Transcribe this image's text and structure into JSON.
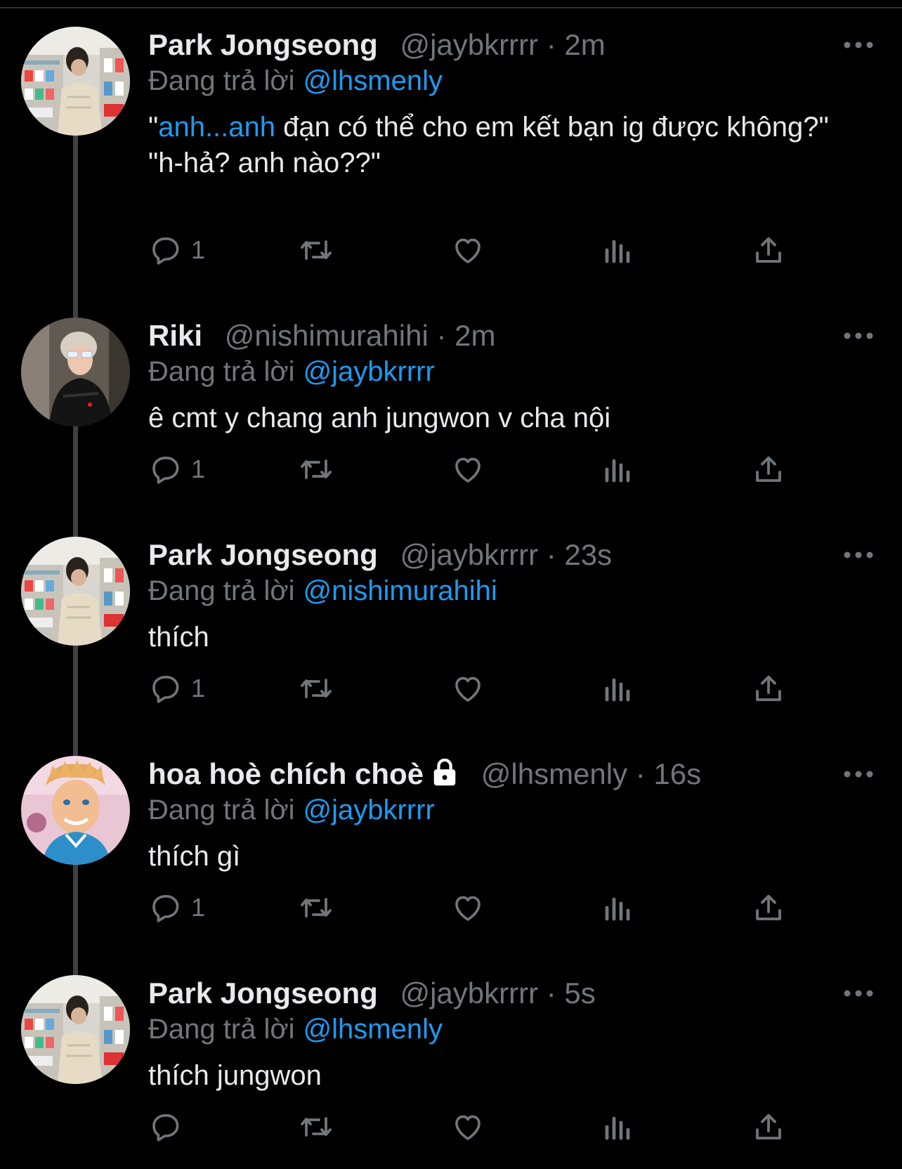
{
  "tweets": [
    {
      "name": "Park Jongseong",
      "handle": "@jaybkrrrr",
      "separator": "·",
      "time": "2m",
      "reply_prefix": "Đang trả lời",
      "reply_mention": "@lhsmenly",
      "text_quote_open": "\"",
      "text_link": "anh...anh",
      "text_rest": " đạn có thể cho em kết bạn ig được không?\"",
      "text_line2": "\"h-hả? anh nào??\"",
      "reply_count": "1",
      "avatar_icon": "avatar-photo-store-shelves"
    },
    {
      "name": "Riki",
      "handle": "@nishimurahihi",
      "separator": "·",
      "time": "2m",
      "reply_prefix": "Đang trả lời",
      "reply_mention": "@jaybkrrrr",
      "text": "ê cmt y chang anh jungwon v cha nội",
      "reply_count": "1",
      "avatar_icon": "avatar-photo-mirror-selfie"
    },
    {
      "name": "Park Jongseong",
      "handle": "@jaybkrrrr",
      "separator": "·",
      "time": "23s",
      "reply_prefix": "Đang trả lời",
      "reply_mention": "@nishimurahihi",
      "text": "thích",
      "reply_count": "1",
      "avatar_icon": "avatar-photo-store-shelves"
    },
    {
      "name": "hoa hoè chích choè",
      "handle": "@lhsmenly",
      "separator": "·",
      "time": "16s",
      "reply_prefix": "Đang trả lời",
      "reply_mention": "@jaybkrrrr",
      "text": "thích gì",
      "reply_count": "1",
      "protected_icon": "lock-icon",
      "avatar_icon": "avatar-cartoon-ken"
    },
    {
      "name": "Park Jongseong",
      "handle": "@jaybkrrrr",
      "separator": "·",
      "time": "5s",
      "reply_prefix": "Đang trả lời",
      "reply_mention": "@lhsmenly",
      "text": "thích jungwon",
      "reply_count": "",
      "avatar_icon": "avatar-photo-store-shelves"
    }
  ],
  "action_icons": [
    "reply-icon",
    "retweet-icon",
    "like-icon",
    "views-icon",
    "share-icon"
  ],
  "colors": {
    "background": "#000000",
    "primary_text": "#e7e9ea",
    "secondary_text": "#71767b",
    "link": "#1d9bf0",
    "thread_line": "#3e4144"
  }
}
